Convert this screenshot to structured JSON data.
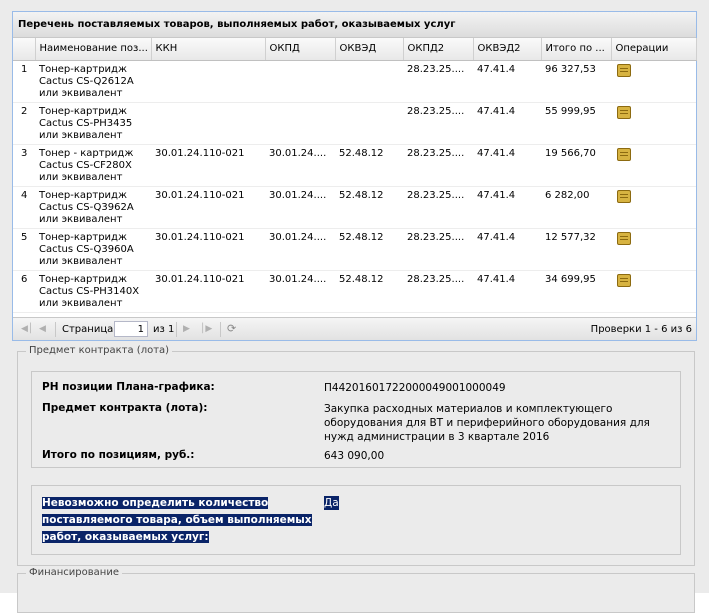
{
  "panel": {
    "title": "Перечень поставляемых товаров, выполняемых работ, оказываемых услуг"
  },
  "grid": {
    "columns": [
      "",
      "Наименование поз...",
      "ККН",
      "ОКПД",
      "ОКВЭД",
      "ОКПД2",
      "ОКВЭД2",
      "Итого по ...",
      "Операции"
    ],
    "rows": [
      {
        "num": "1",
        "name": "Тонер-картридж Cactus CS-Q2612A или эквивалент",
        "kkn": "",
        "okpd": "",
        "okved": "",
        "okpd2": "28.23.25....",
        "okved2": "47.41.4",
        "total": "96 327,53"
      },
      {
        "num": "2",
        "name": "Тонер-картридж Cactus CS-PH3435 или эквивалент",
        "kkn": "",
        "okpd": "",
        "okved": "",
        "okpd2": "28.23.25....",
        "okved2": "47.41.4",
        "total": "55 999,95"
      },
      {
        "num": "3",
        "name": "Тонер - картридж Cactus CS-CF280X или эквивалент",
        "kkn": "30.01.24.110-021",
        "okpd": "30.01.24....",
        "okved": "52.48.12",
        "okpd2": "28.23.25....",
        "okved2": "47.41.4",
        "total": "19 566,70"
      },
      {
        "num": "4",
        "name": "Тонер-картридж Cactus CS-Q3962A или эквивалент",
        "kkn": "30.01.24.110-021",
        "okpd": "30.01.24....",
        "okved": "52.48.12",
        "okpd2": "28.23.25....",
        "okved2": "47.41.4",
        "total": "6 282,00"
      },
      {
        "num": "5",
        "name": "Тонер-картридж Cactus CS-Q3960A или эквивалент",
        "kkn": "30.01.24.110-021",
        "okpd": "30.01.24....",
        "okved": "52.48.12",
        "okpd2": "28.23.25....",
        "okved2": "47.41.4",
        "total": "12 577,32"
      },
      {
        "num": "6",
        "name": "Тонер-картридж Cactus CS-PH3140X или эквивалент",
        "kkn": "30.01.24.110-021",
        "okpd": "30.01.24....",
        "okved": "52.48.12",
        "okpd2": "28.23.25....",
        "okved2": "47.41.4",
        "total": "34 699,95"
      }
    ]
  },
  "pager": {
    "page_label": "Страница",
    "page_value": "1",
    "of_label": "из 1",
    "records": "Проверки 1 - 6 из 6"
  },
  "contract": {
    "legend": "Предмет контракта (лота)",
    "rn_label": "РН позиции Плана-графика:",
    "rn_value": "П44201601722000049001000049",
    "subject_label": "Предмет контракта (лота):",
    "subject_value": "Закупка расходных материалов и комплектующего оборудования для ВТ и периферийного оборудования для нужд администрации в 3 квартале 2016",
    "total_label": "Итого по позициям, руб.:",
    "total_value": "643 090,00",
    "impossible_label_1": "Невозможно определить количество",
    "impossible_label_2": "поставляемого товара, объем выполняемых",
    "impossible_label_3": "работ, оказываемых услуг:",
    "impossible_value": "Да"
  },
  "financing": {
    "legend": "Финансирование"
  }
}
